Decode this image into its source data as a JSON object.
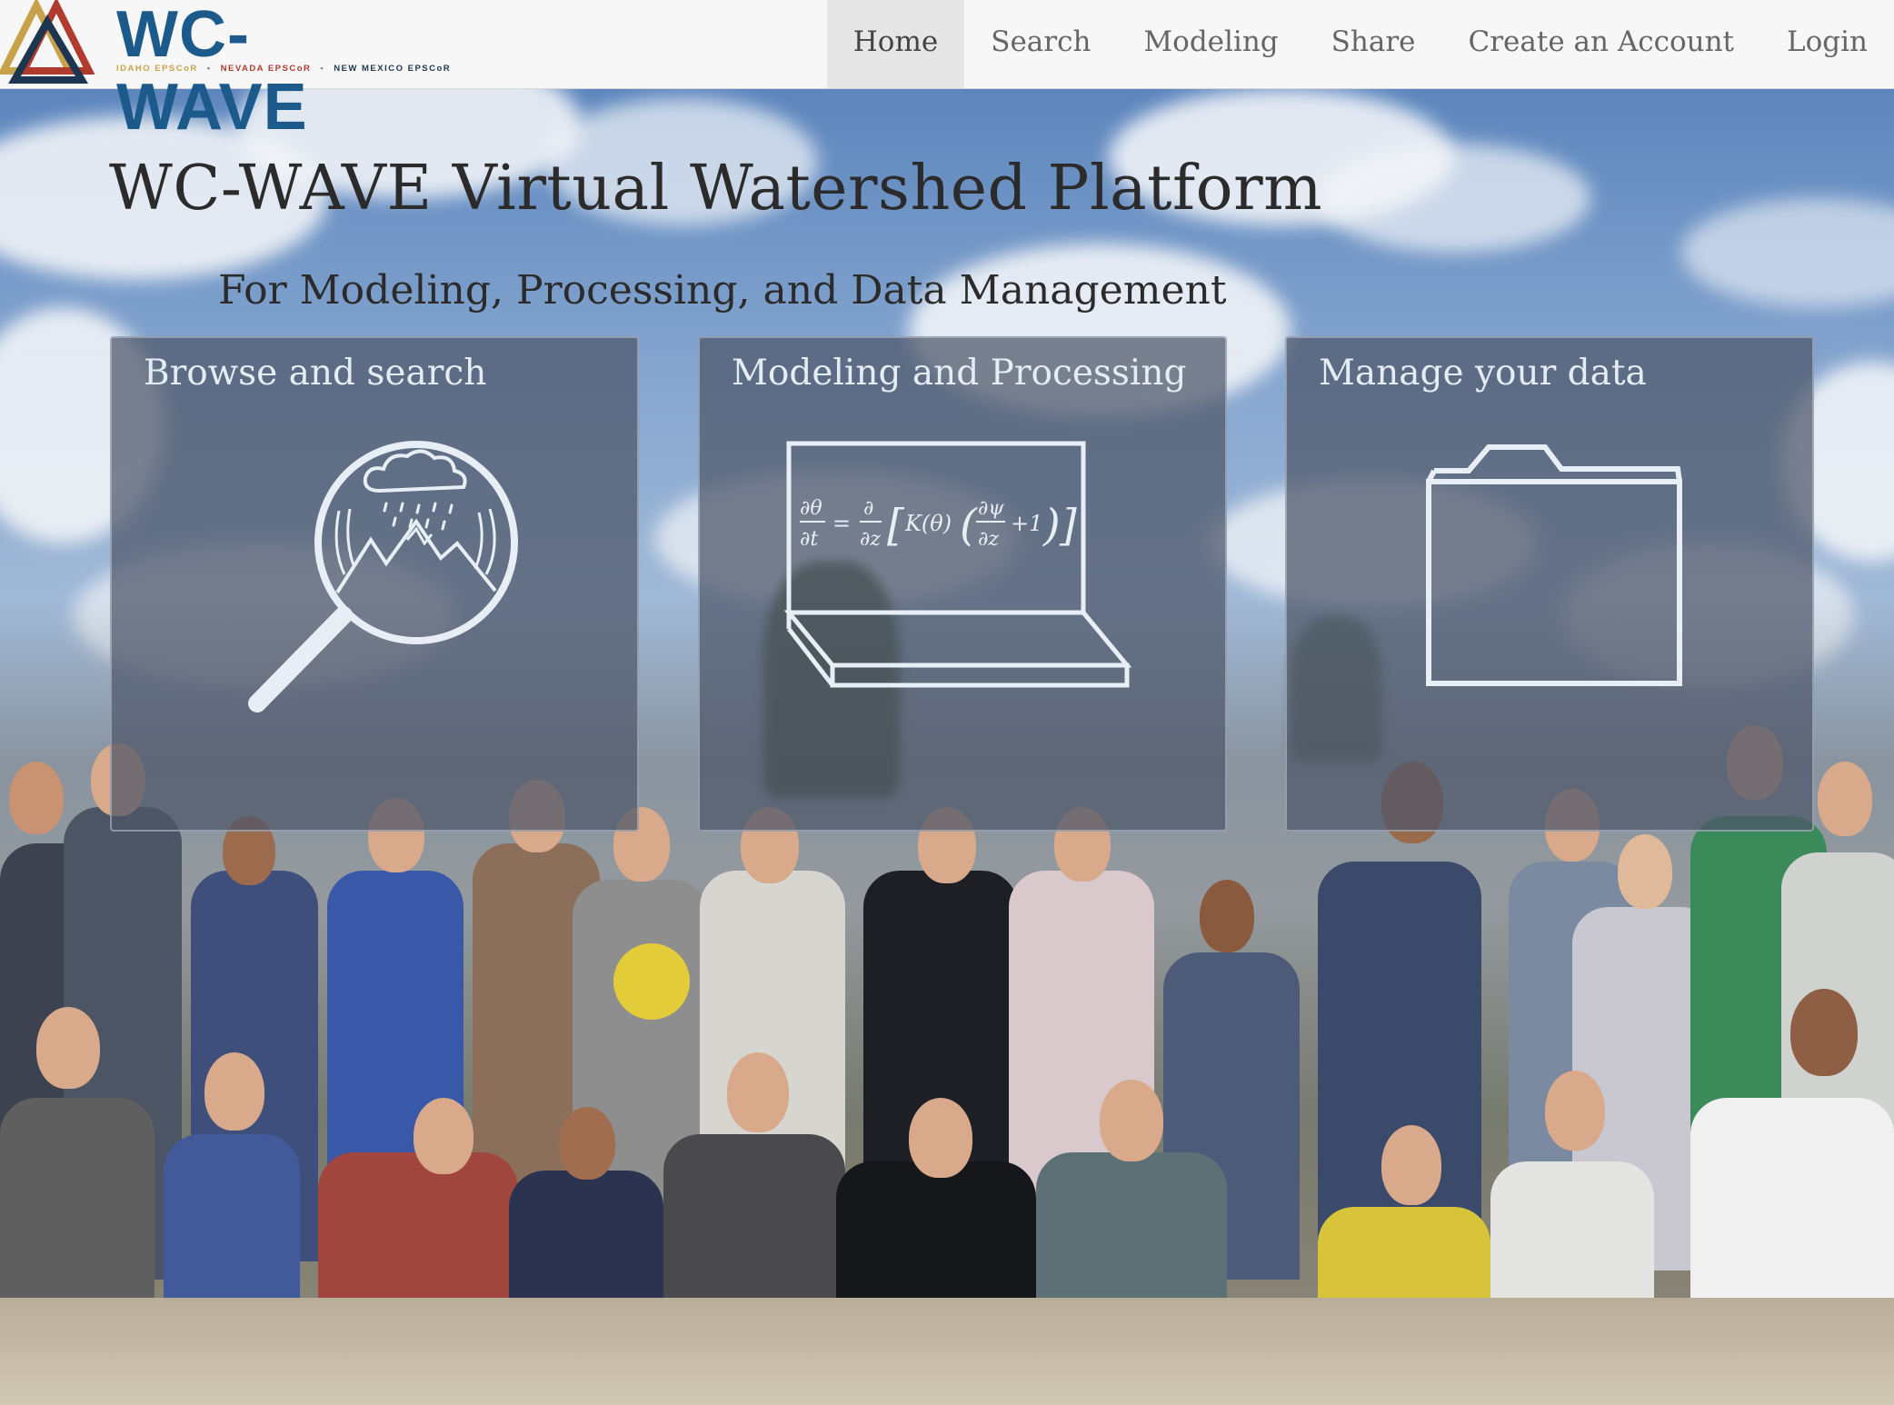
{
  "brand": {
    "name": "WC-WAVE",
    "partners": [
      "IDAHO EPSCoR",
      "NEVADA EPSCoR",
      "NEW MEXICO EPSCoR"
    ],
    "colors": {
      "gold": "#c8a24a",
      "red": "#b03a2e",
      "navy": "#1d3650",
      "blue": "#1d5a8c"
    }
  },
  "nav": {
    "items": [
      {
        "label": "Home",
        "active": true
      },
      {
        "label": "Search"
      },
      {
        "label": "Modeling"
      },
      {
        "label": "Share"
      },
      {
        "label": "Create an Account"
      },
      {
        "label": "Login"
      }
    ]
  },
  "hero": {
    "title": "WC-WAVE Virtual Watershed Platform",
    "subtitle": "For Modeling, Processing, and Data Management"
  },
  "panels": [
    {
      "title": "Browse and search",
      "icon": "magnifier-mountain-icon"
    },
    {
      "title": "Modeling and Processing",
      "icon": "laptop-equation-icon"
    },
    {
      "title": "Manage your data",
      "icon": "folder-icon"
    }
  ]
}
